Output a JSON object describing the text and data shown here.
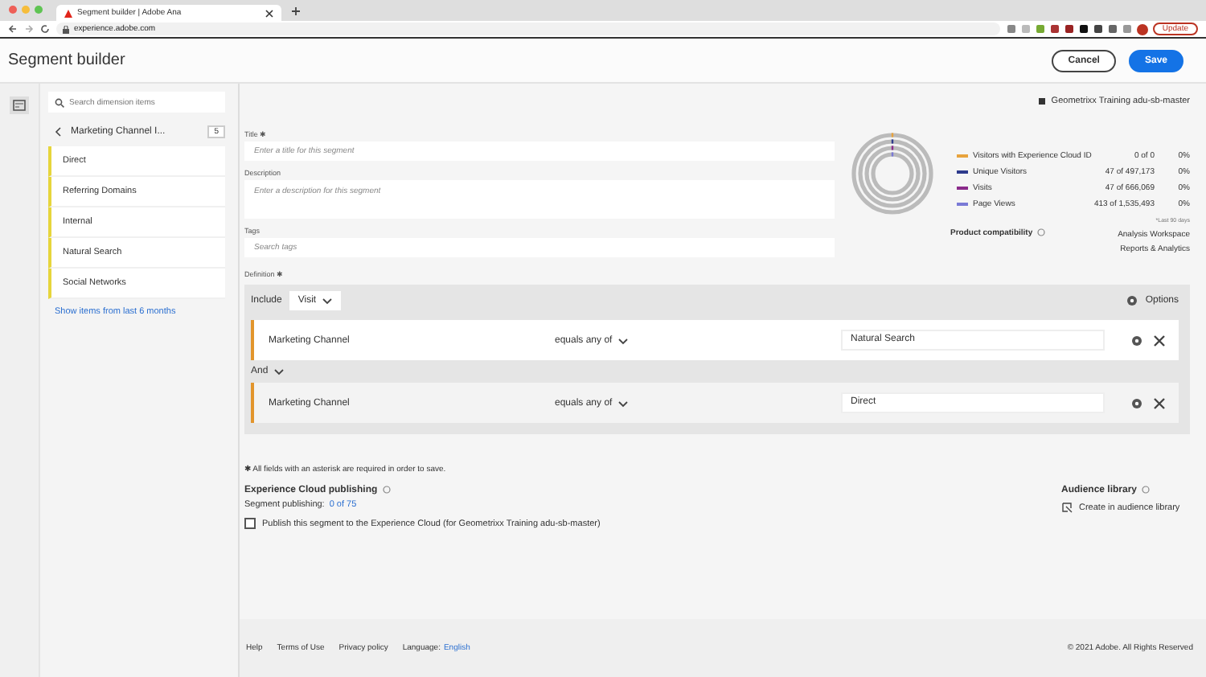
{
  "browser": {
    "tab_title": "Segment builder | Adobe Ana",
    "url": "experience.adobe.com",
    "update_label": "Update"
  },
  "header": {
    "title": "Segment builder",
    "buttons": [
      {
        "label": "Cancel",
        "kind": "secondary"
      },
      {
        "label": "Save",
        "kind": "primary"
      }
    ]
  },
  "sidebar": {
    "search": {
      "placeholder": "Search dimension items"
    },
    "breadcrumb": "Marketing Channel I...",
    "count": "5",
    "items": [
      {
        "label": "Direct"
      },
      {
        "label": "Referring Domains"
      },
      {
        "label": "Internal"
      },
      {
        "label": "Natural Search"
      },
      {
        "label": "Social Networks"
      }
    ],
    "link": "Show items from last 6 months"
  },
  "form": {
    "title_label": "Title ✱",
    "title_placeholder": "Enter a title for this segment",
    "description_label": "Description",
    "description_placeholder": "Enter a description for this segment",
    "tags_label": "Tags",
    "tags_placeholder": "Search tags",
    "definition_label": "Definition ✱"
  },
  "suite": "Geometrixx Training adu-sb-master",
  "summary": {
    "metrics": [
      {
        "name": "Visitors with Experience Cloud ID",
        "value": "0 of 0",
        "percent": "0%",
        "color": "#e8a33d"
      },
      {
        "name": "Unique Visitors",
        "value": "47 of 497,173",
        "percent": "0%",
        "color": "#2d3a8c"
      },
      {
        "name": "Visits",
        "value": "47 of 666,069",
        "percent": "0%",
        "color": "#8a2a8a"
      },
      {
        "name": "Page Views",
        "value": "413 of 1,535,493",
        "percent": "0%",
        "color": "#7a7ad6"
      }
    ],
    "footnote": "*Last 90 days",
    "compat_label": "Product compatibility",
    "compat_values": [
      "Analysis Workspace",
      "Reports & Analytics"
    ]
  },
  "definition": {
    "include_label": "Include",
    "scope": "Visit",
    "options_label": "Options",
    "rules": [
      {
        "dimension": "Marketing Channel",
        "operator": "equals any of",
        "value": "Natural Search",
        "selected": true
      },
      {
        "dimension": "Marketing Channel",
        "operator": "equals any of",
        "value": "Direct",
        "selected": false
      }
    ],
    "connector": "And"
  },
  "required_note": "✱ All fields with an asterisk are required in order to save.",
  "publishing": {
    "title": "Experience Cloud publishing",
    "status_label": "Segment publishing:",
    "status_value": "0 of 75",
    "checkbox_label": "Publish this segment to the Experience Cloud (for Geometrixx Training adu-sb-master)",
    "checked": false
  },
  "audience": {
    "title": "Audience library",
    "action": "Create in audience library"
  },
  "footer": {
    "links": [
      "Help",
      "Terms of Use",
      "Privacy policy"
    ],
    "language_label": "Language:",
    "language": "English",
    "copyright": "© 2021 Adobe. All Rights Reserved"
  }
}
